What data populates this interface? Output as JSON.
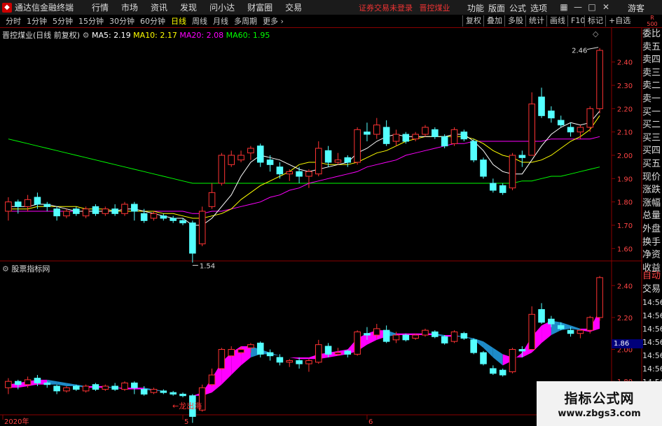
{
  "titlebar": {
    "app_title": "通达信金融终端",
    "menu": [
      "行情",
      "市场",
      "资讯",
      "发现",
      "问小达",
      "财富圈",
      "交易"
    ],
    "broker_status": "证券交易未登录",
    "stock_short": "晋控煤业",
    "right_menu": [
      "功能",
      "版面",
      "公式",
      "选项"
    ],
    "guest": "游客"
  },
  "toolbar": {
    "periods": [
      "分时",
      "1分钟",
      "5分钟",
      "15分钟",
      "30分钟",
      "60分钟",
      "日线",
      "周线",
      "月线",
      "多周期",
      "更多"
    ],
    "active_period": "日线",
    "buttons": [
      "复权",
      "叠加",
      "多股",
      "统计",
      "画线",
      "F10",
      "标记",
      "+自选"
    ],
    "corner_top": "R",
    "corner_bottom": "500"
  },
  "main_chart": {
    "stock_name": "晋控煤业(日线 前复权)",
    "ma5_label": "MA5: 2.19",
    "ma10_label": "MA10: 2.17",
    "ma20_label": "MA20: 2.08",
    "ma60_label": "MA60: 1.95",
    "price_ticks": [
      "2.40",
      "2.30",
      "2.20",
      "2.10",
      "2.00",
      "1.90",
      "1.80",
      "1.70",
      "1.60"
    ],
    "high_label": "2.46",
    "low_label": "1.54"
  },
  "lower_chart": {
    "title": "股票指标网",
    "price_ticks": [
      "2.40",
      "2.20",
      "2.00",
      "1.80"
    ],
    "badge": "1.86",
    "annotation": "←龙出海"
  },
  "x_axis": {
    "labels": [
      "2020年",
      "5",
      "6"
    ]
  },
  "side_panel": {
    "items": [
      "委比",
      "卖五",
      "卖四",
      "卖三",
      "卖二",
      "卖一",
      "买一",
      "买二",
      "买三",
      "买四",
      "买五",
      "现价",
      "涨跌",
      "涨幅",
      "总量",
      "外盘",
      "换手",
      "净资",
      "收益"
    ],
    "lower_items": [
      "自动",
      "交易",
      "14:56",
      "14:56",
      "14:56",
      "14:56",
      "14:56",
      "14:56",
      "14:56",
      "14:56"
    ]
  },
  "watermark": {
    "cn": "指标公式网",
    "url": "www.zbgs3.com"
  },
  "colors": {
    "up": "#ff3333",
    "down": "#54ffff",
    "ma5": "#ffffff",
    "ma10": "#ffff00",
    "ma20": "#ff00ff",
    "ma60": "#00ff00",
    "ribbon_up": "#ff00ff",
    "ribbon_down": "#1e8bc8",
    "grid": "#8b0000"
  },
  "chart_data": {
    "type": "candlestick",
    "candles": [
      {
        "o": 1.76,
        "c": 1.8,
        "h": 1.82,
        "l": 1.72
      },
      {
        "o": 1.8,
        "c": 1.78,
        "h": 1.81,
        "l": 1.75
      },
      {
        "o": 1.78,
        "c": 1.81,
        "h": 1.83,
        "l": 1.76
      },
      {
        "o": 1.82,
        "c": 1.79,
        "h": 1.84,
        "l": 1.77
      },
      {
        "o": 1.79,
        "c": 1.78,
        "h": 1.8,
        "l": 1.76
      },
      {
        "o": 1.77,
        "c": 1.74,
        "h": 1.78,
        "l": 1.72
      },
      {
        "o": 1.74,
        "c": 1.76,
        "h": 1.77,
        "l": 1.73
      },
      {
        "o": 1.77,
        "c": 1.75,
        "h": 1.78,
        "l": 1.74
      },
      {
        "o": 1.74,
        "c": 1.77,
        "h": 1.78,
        "l": 1.73
      },
      {
        "o": 1.78,
        "c": 1.75,
        "h": 1.79,
        "l": 1.74
      },
      {
        "o": 1.75,
        "c": 1.77,
        "h": 1.78,
        "l": 1.74
      },
      {
        "o": 1.77,
        "c": 1.75,
        "h": 1.79,
        "l": 1.74
      },
      {
        "o": 1.75,
        "c": 1.79,
        "h": 1.8,
        "l": 1.74
      },
      {
        "o": 1.79,
        "c": 1.76,
        "h": 1.8,
        "l": 1.72
      },
      {
        "o": 1.75,
        "c": 1.72,
        "h": 1.77,
        "l": 1.71
      },
      {
        "o": 1.73,
        "c": 1.75,
        "h": 1.76,
        "l": 1.72
      },
      {
        "o": 1.74,
        "c": 1.73,
        "h": 1.75,
        "l": 1.72
      },
      {
        "o": 1.73,
        "c": 1.72,
        "h": 1.74,
        "l": 1.71
      },
      {
        "o": 1.72,
        "c": 1.71,
        "h": 1.73,
        "l": 1.7
      },
      {
        "o": 1.71,
        "c": 1.58,
        "h": 1.72,
        "l": 1.54
      },
      {
        "o": 1.62,
        "c": 1.76,
        "h": 1.78,
        "l": 1.61
      },
      {
        "o": 1.78,
        "c": 1.84,
        "h": 1.88,
        "l": 1.77
      },
      {
        "o": 1.88,
        "c": 2.0,
        "h": 2.01,
        "l": 1.87
      },
      {
        "o": 1.96,
        "c": 2.0,
        "h": 2.02,
        "l": 1.95
      },
      {
        "o": 1.98,
        "c": 2.0,
        "h": 2.02,
        "l": 1.97
      },
      {
        "o": 2.01,
        "c": 2.03,
        "h": 2.04,
        "l": 1.98
      },
      {
        "o": 2.04,
        "c": 1.97,
        "h": 2.05,
        "l": 1.95
      },
      {
        "o": 1.98,
        "c": 1.96,
        "h": 2.0,
        "l": 1.93
      },
      {
        "o": 1.95,
        "c": 1.92,
        "h": 1.97,
        "l": 1.9
      },
      {
        "o": 1.92,
        "c": 1.93,
        "h": 1.94,
        "l": 1.89
      },
      {
        "o": 1.93,
        "c": 1.91,
        "h": 1.95,
        "l": 1.88
      },
      {
        "o": 1.91,
        "c": 1.93,
        "h": 1.94,
        "l": 1.86
      },
      {
        "o": 1.92,
        "c": 2.03,
        "h": 2.06,
        "l": 1.91
      },
      {
        "o": 2.02,
        "c": 1.97,
        "h": 2.04,
        "l": 1.95
      },
      {
        "o": 1.97,
        "c": 1.98,
        "h": 2.01,
        "l": 1.96
      },
      {
        "o": 1.99,
        "c": 1.97,
        "h": 2.0,
        "l": 1.95
      },
      {
        "o": 1.97,
        "c": 2.11,
        "h": 2.12,
        "l": 1.96
      },
      {
        "o": 2.1,
        "c": 2.09,
        "h": 2.14,
        "l": 2.06
      },
      {
        "o": 2.09,
        "c": 2.13,
        "h": 2.16,
        "l": 2.07
      },
      {
        "o": 2.12,
        "c": 2.05,
        "h": 2.15,
        "l": 2.04
      },
      {
        "o": 2.06,
        "c": 2.09,
        "h": 2.11,
        "l": 2.04
      },
      {
        "o": 2.09,
        "c": 2.06,
        "h": 2.1,
        "l": 2.05
      },
      {
        "o": 2.07,
        "c": 2.09,
        "h": 2.1,
        "l": 2.06
      },
      {
        "o": 2.09,
        "c": 2.12,
        "h": 2.13,
        "l": 2.08
      },
      {
        "o": 2.11,
        "c": 2.08,
        "h": 2.12,
        "l": 2.07
      },
      {
        "o": 2.08,
        "c": 2.04,
        "h": 2.09,
        "l": 2.03
      },
      {
        "o": 2.05,
        "c": 2.11,
        "h": 2.12,
        "l": 2.04
      },
      {
        "o": 2.1,
        "c": 2.07,
        "h": 2.11,
        "l": 2.06
      },
      {
        "o": 2.06,
        "c": 1.98,
        "h": 2.07,
        "l": 1.97
      },
      {
        "o": 1.98,
        "c": 1.91,
        "h": 1.99,
        "l": 1.9
      },
      {
        "o": 1.88,
        "c": 1.85,
        "h": 1.9,
        "l": 1.84
      },
      {
        "o": 1.87,
        "c": 1.84,
        "h": 1.88,
        "l": 1.83
      },
      {
        "o": 1.86,
        "c": 2.0,
        "h": 2.01,
        "l": 1.85
      },
      {
        "o": 2.0,
        "c": 1.99,
        "h": 2.02,
        "l": 1.95
      },
      {
        "o": 2.0,
        "c": 2.22,
        "h": 2.27,
        "l": 2.0
      },
      {
        "o": 2.25,
        "c": 2.17,
        "h": 2.29,
        "l": 2.16
      },
      {
        "o": 2.19,
        "c": 2.16,
        "h": 2.21,
        "l": 2.14
      },
      {
        "o": 2.15,
        "c": 2.13,
        "h": 2.17,
        "l": 2.12
      },
      {
        "o": 2.12,
        "c": 2.1,
        "h": 2.14,
        "l": 2.08
      },
      {
        "o": 2.1,
        "c": 2.12,
        "h": 2.13,
        "l": 2.07
      },
      {
        "o": 2.12,
        "c": 2.2,
        "h": 2.21,
        "l": 2.1
      },
      {
        "o": 2.2,
        "c": 2.45,
        "h": 2.46,
        "l": 2.18
      }
    ],
    "ma5": [
      1.78,
      1.78,
      1.78,
      1.79,
      1.79,
      1.78,
      1.77,
      1.76,
      1.76,
      1.76,
      1.76,
      1.76,
      1.77,
      1.77,
      1.76,
      1.75,
      1.74,
      1.73,
      1.73,
      1.7,
      1.7,
      1.73,
      1.78,
      1.83,
      1.91,
      1.97,
      2.0,
      1.99,
      1.98,
      1.96,
      1.94,
      1.93,
      1.94,
      1.95,
      1.96,
      1.97,
      2.01,
      2.03,
      2.06,
      2.08,
      2.09,
      2.08,
      2.08,
      2.08,
      2.08,
      2.08,
      2.09,
      2.09,
      2.06,
      2.02,
      1.96,
      1.93,
      1.92,
      1.92,
      1.98,
      2.04,
      2.09,
      2.12,
      2.14,
      2.13,
      2.14,
      2.19
    ],
    "ma10": [
      1.77,
      1.77,
      1.77,
      1.78,
      1.78,
      1.78,
      1.78,
      1.78,
      1.77,
      1.77,
      1.77,
      1.76,
      1.76,
      1.76,
      1.76,
      1.76,
      1.75,
      1.75,
      1.74,
      1.73,
      1.73,
      1.74,
      1.75,
      1.77,
      1.81,
      1.84,
      1.87,
      1.89,
      1.91,
      1.93,
      1.96,
      1.97,
      1.97,
      1.96,
      1.96,
      1.96,
      1.97,
      1.99,
      2.01,
      2.02,
      2.04,
      2.06,
      2.07,
      2.08,
      2.08,
      2.08,
      2.08,
      2.08,
      2.07,
      2.05,
      2.02,
      2.0,
      1.99,
      1.97,
      1.97,
      1.98,
      2.0,
      2.03,
      2.06,
      2.08,
      2.11,
      2.17
    ],
    "ma20": [
      1.76,
      1.76,
      1.76,
      1.76,
      1.76,
      1.76,
      1.76,
      1.76,
      1.76,
      1.76,
      1.76,
      1.76,
      1.76,
      1.76,
      1.76,
      1.76,
      1.76,
      1.76,
      1.76,
      1.75,
      1.75,
      1.76,
      1.76,
      1.77,
      1.78,
      1.79,
      1.8,
      1.82,
      1.83,
      1.85,
      1.86,
      1.88,
      1.89,
      1.9,
      1.91,
      1.92,
      1.93,
      1.95,
      1.96,
      1.97,
      1.98,
      2.0,
      2.01,
      2.02,
      2.03,
      2.04,
      2.05,
      2.05,
      2.06,
      2.06,
      2.06,
      2.06,
      2.06,
      2.06,
      2.06,
      2.06,
      2.07,
      2.07,
      2.07,
      2.07,
      2.07,
      2.08
    ],
    "ma60": [
      2.07,
      2.06,
      2.05,
      2.04,
      2.03,
      2.02,
      2.01,
      2.0,
      1.99,
      1.98,
      1.97,
      1.96,
      1.95,
      1.94,
      1.93,
      1.92,
      1.91,
      1.9,
      1.89,
      1.88,
      1.88,
      1.88,
      1.88,
      1.88,
      1.88,
      1.88,
      1.88,
      1.88,
      1.88,
      1.88,
      1.88,
      1.88,
      1.88,
      1.88,
      1.88,
      1.88,
      1.88,
      1.88,
      1.88,
      1.88,
      1.88,
      1.88,
      1.88,
      1.88,
      1.88,
      1.88,
      1.88,
      1.88,
      1.88,
      1.88,
      1.88,
      1.88,
      1.88,
      1.89,
      1.89,
      1.9,
      1.91,
      1.91,
      1.92,
      1.93,
      1.94,
      1.95
    ],
    "ylim_main": [
      1.52,
      2.48
    ],
    "ylim_lower": [
      1.7,
      2.48
    ],
    "lower_ribbon_top": [
      1.78,
      1.79,
      1.8,
      1.81,
      1.81,
      1.8,
      1.79,
      1.78,
      1.77,
      1.77,
      1.77,
      1.76,
      1.76,
      1.76,
      1.76,
      1.75,
      1.74,
      1.73,
      1.72,
      1.71,
      1.73,
      1.82,
      1.92,
      1.98,
      2.02,
      2.02,
      2.0,
      1.98,
      1.96,
      1.95,
      1.95,
      1.95,
      1.97,
      1.98,
      1.99,
      2.0,
      2.07,
      2.1,
      2.12,
      2.12,
      2.1,
      2.1,
      2.1,
      2.1,
      2.1,
      2.09,
      2.09,
      2.08,
      2.06,
      2.01,
      1.95,
      1.9,
      1.93,
      1.98,
      2.08,
      2.15,
      2.18,
      2.17,
      2.15,
      2.13,
      2.13,
      2.25
    ],
    "lower_ribbon_bottom": [
      1.76,
      1.76,
      1.77,
      1.78,
      1.78,
      1.78,
      1.77,
      1.77,
      1.76,
      1.76,
      1.76,
      1.76,
      1.75,
      1.75,
      1.75,
      1.74,
      1.74,
      1.73,
      1.72,
      1.71,
      1.71,
      1.73,
      1.78,
      1.84,
      1.9,
      1.95,
      1.97,
      1.97,
      1.96,
      1.95,
      1.94,
      1.94,
      1.94,
      1.95,
      1.96,
      1.97,
      1.99,
      2.03,
      2.06,
      2.08,
      2.09,
      2.09,
      2.09,
      2.09,
      2.09,
      2.08,
      2.08,
      2.08,
      2.07,
      2.05,
      2.01,
      1.97,
      1.95,
      1.95,
      1.98,
      2.04,
      2.09,
      2.12,
      2.13,
      2.12,
      2.11,
      2.13
    ]
  }
}
